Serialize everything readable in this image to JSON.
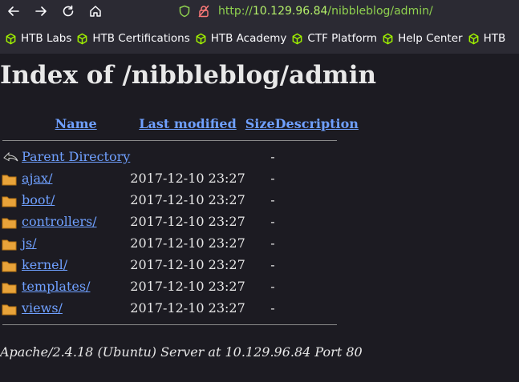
{
  "browser": {
    "url_prefix": "http://",
    "url_host": "10.129.96.84",
    "url_path": "/nibbleblog/admin/",
    "back_icon": "arrow-left-icon",
    "forward_icon": "arrow-right-icon",
    "reload_icon": "reload-icon",
    "home_icon": "home-icon",
    "shield_icon": "shield-icon",
    "lock_icon": "lock-warning-icon",
    "bookmarks": [
      "HTB Labs",
      "HTB Certifications",
      "HTB Academy",
      "CTF Platform",
      "Help Center",
      "HTB"
    ],
    "bookmark_color": "#9fef00"
  },
  "page": {
    "title": "Index of /nibbleblog/admin",
    "columns": {
      "name": "Name",
      "modified": "Last modified",
      "size": "Size",
      "description": "Description"
    },
    "parent": {
      "name": "Parent Directory",
      "size": "-"
    },
    "rows": [
      {
        "name": "ajax/",
        "modified": "2017-12-10 23:27",
        "size": "-"
      },
      {
        "name": "boot/",
        "modified": "2017-12-10 23:27",
        "size": "-"
      },
      {
        "name": "controllers/",
        "modified": "2017-12-10 23:27",
        "size": "-"
      },
      {
        "name": "js/",
        "modified": "2017-12-10 23:27",
        "size": "-"
      },
      {
        "name": "kernel/",
        "modified": "2017-12-10 23:27",
        "size": "-"
      },
      {
        "name": "templates/",
        "modified": "2017-12-10 23:27",
        "size": "-"
      },
      {
        "name": "views/",
        "modified": "2017-12-10 23:27",
        "size": "-"
      }
    ],
    "footer": "Apache/2.4.18 (Ubuntu) Server at 10.129.96.84 Port 80"
  }
}
